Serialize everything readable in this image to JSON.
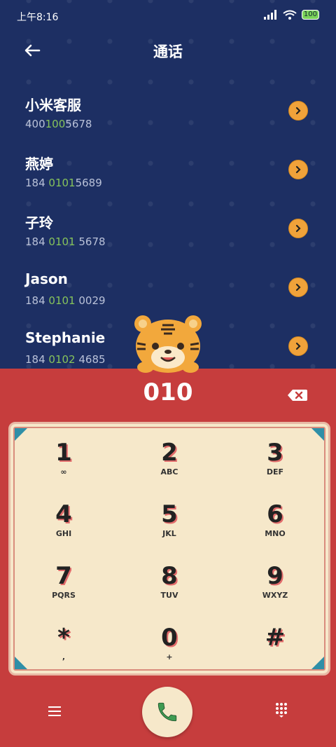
{
  "status": {
    "time": "上午8:16",
    "battery": "100"
  },
  "header": {
    "title": "通话"
  },
  "contacts": [
    {
      "name": "小米客服",
      "num_pre": "400",
      "num_hl": "100",
      "num_post": "5678"
    },
    {
      "name": "燕婷",
      "num_pre": "184 ",
      "num_hl": "0101",
      "num_post": "5689"
    },
    {
      "name": "子玲",
      "num_pre": "184 ",
      "num_hl": "0101",
      "num_post": " 5678"
    },
    {
      "name": "Jason",
      "num_pre": "184 ",
      "num_hl": "0101",
      "num_post": " 0029"
    },
    {
      "name": "Stephanie",
      "num_pre": "184 ",
      "num_hl": "0102",
      "num_post": " 4685"
    }
  ],
  "dialer": {
    "digits": "010"
  },
  "keys": [
    {
      "d": "1",
      "l": "∞"
    },
    {
      "d": "2",
      "l": "ABC"
    },
    {
      "d": "3",
      "l": "DEF"
    },
    {
      "d": "4",
      "l": "GHI"
    },
    {
      "d": "5",
      "l": "JKL"
    },
    {
      "d": "6",
      "l": "MNO"
    },
    {
      "d": "7",
      "l": "PQRS"
    },
    {
      "d": "8",
      "l": "TUV"
    },
    {
      "d": "9",
      "l": "WXYZ"
    },
    {
      "d": "*",
      "l": ","
    },
    {
      "d": "0",
      "l": "+"
    },
    {
      "d": "#",
      "l": ""
    }
  ],
  "colors": {
    "background_top": "#1d2f63",
    "dialer_red": "#c63d3d",
    "keypad_cream": "#f6e8ca",
    "highlight_green": "#86c35b",
    "accent_orange": "#f0a23a"
  }
}
